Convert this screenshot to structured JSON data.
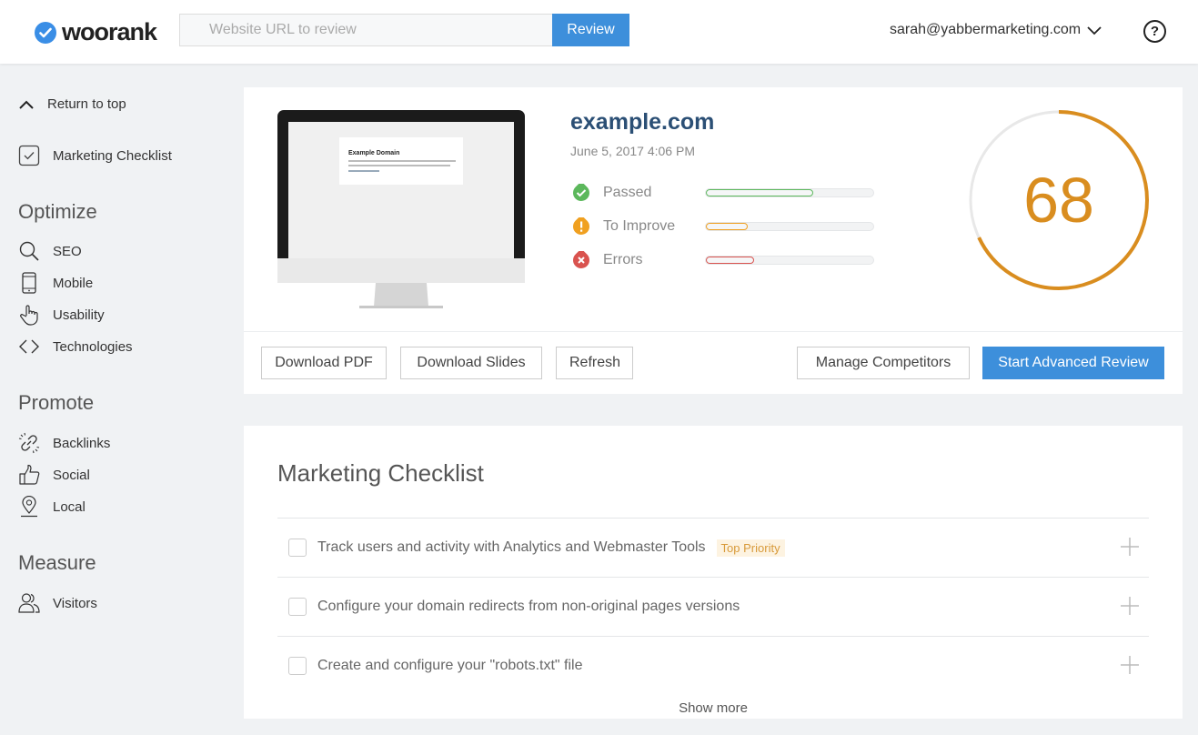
{
  "header": {
    "logo": "woorank",
    "url_placeholder": "Website URL to review",
    "review_label": "Review",
    "user_email": "sarah@yabbermarketing.com",
    "help_label": "?"
  },
  "sidebar": {
    "return_top": "Return to top",
    "marketing_checklist": "Marketing Checklist",
    "sections": [
      {
        "title": "Optimize",
        "items": [
          {
            "label": "SEO",
            "icon": "search-icon"
          },
          {
            "label": "Mobile",
            "icon": "mobile-icon"
          },
          {
            "label": "Usability",
            "icon": "pointer-hand-icon"
          },
          {
            "label": "Technologies",
            "icon": "code-icon"
          }
        ]
      },
      {
        "title": "Promote",
        "items": [
          {
            "label": "Backlinks",
            "icon": "link-icon"
          },
          {
            "label": "Social",
            "icon": "thumbs-up-icon"
          },
          {
            "label": "Local",
            "icon": "map-pin-icon"
          }
        ]
      },
      {
        "title": "Measure",
        "items": [
          {
            "label": "Visitors",
            "icon": "users-icon"
          }
        ]
      }
    ]
  },
  "report": {
    "domain": "example.com",
    "date": "June 5, 2017 4:06 PM",
    "preview_heading": "Example Domain",
    "stats": [
      {
        "label": "Passed",
        "fraction": 0.64,
        "color": "#5cb85c"
      },
      {
        "label": "To Improve",
        "fraction": 0.25,
        "color": "#f0a020"
      },
      {
        "label": "Errors",
        "fraction": 0.29,
        "color": "#d9534f"
      }
    ],
    "score": "68",
    "score_fraction": 0.68,
    "score_color": "#d98d1f",
    "buttons": {
      "download_pdf": "Download PDF",
      "download_slides": "Download Slides",
      "refresh": "Refresh",
      "manage_competitors": "Manage Competitors",
      "start_advanced": "Start Advanced Review"
    }
  },
  "checklist": {
    "title": "Marketing Checklist",
    "items": [
      {
        "text": "Track users and activity with Analytics and Webmaster Tools",
        "badge": "Top Priority"
      },
      {
        "text": "Configure your domain redirects from non-original pages versions",
        "badge": ""
      },
      {
        "text": "Create and configure your \"robots.txt\" file",
        "badge": ""
      }
    ],
    "show_more": "Show more"
  }
}
